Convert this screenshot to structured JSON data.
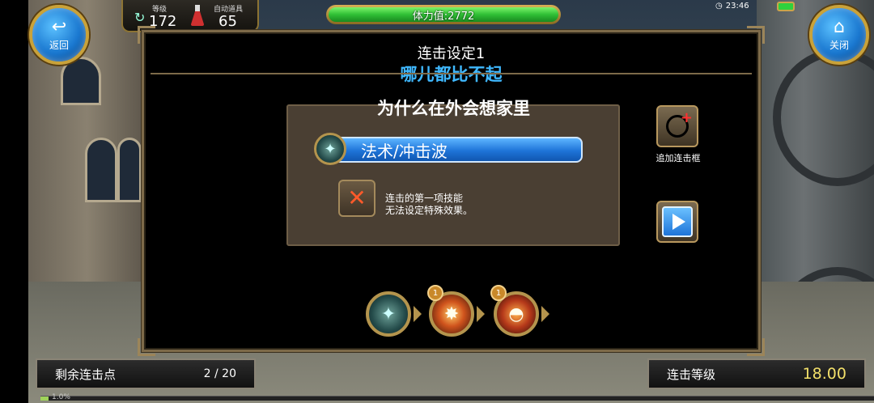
{
  "hud": {
    "back_label": "返回",
    "close_label": "关闭",
    "level_caption": "等级",
    "level_value": "172",
    "auto_item_caption": "自动道具",
    "auto_item_value": "65",
    "stamina_text": "体力值:2772",
    "clock": "23:46",
    "exp_percent": "1.0%",
    "exp_fraction": 0.01
  },
  "dialog": {
    "title": "连击设定1",
    "subtitle": "哪儿都比不起",
    "combo_name": "为什么在外会想家里",
    "skill_name": "法术/冲击波",
    "note_line1": "连击的第一项技能",
    "note_line2": "无法设定特殊效果。",
    "add_frame_label": "追加连击框",
    "icons": {
      "skill": "mage-skill-icon",
      "remove": "close-x-icon",
      "add": "add-frame-icon",
      "play": "play-icon"
    }
  },
  "chain": {
    "slots": [
      {
        "icon": "mage-skill-icon",
        "badge": ""
      },
      {
        "icon": "fire-burst-icon",
        "badge": "1"
      },
      {
        "icon": "fire-dome-icon",
        "badge": "1"
      }
    ]
  },
  "footer": {
    "remaining_label": "剩余连击点",
    "remaining_value": "2 / 20",
    "combo_level_label": "连击等级",
    "combo_level_value": "18.00"
  },
  "colors": {
    "accent_blue": "#3fb8ff",
    "hp_green": "#2fbf35",
    "gold_border": "#b4944d",
    "level_yellow": "#f3e06a"
  }
}
